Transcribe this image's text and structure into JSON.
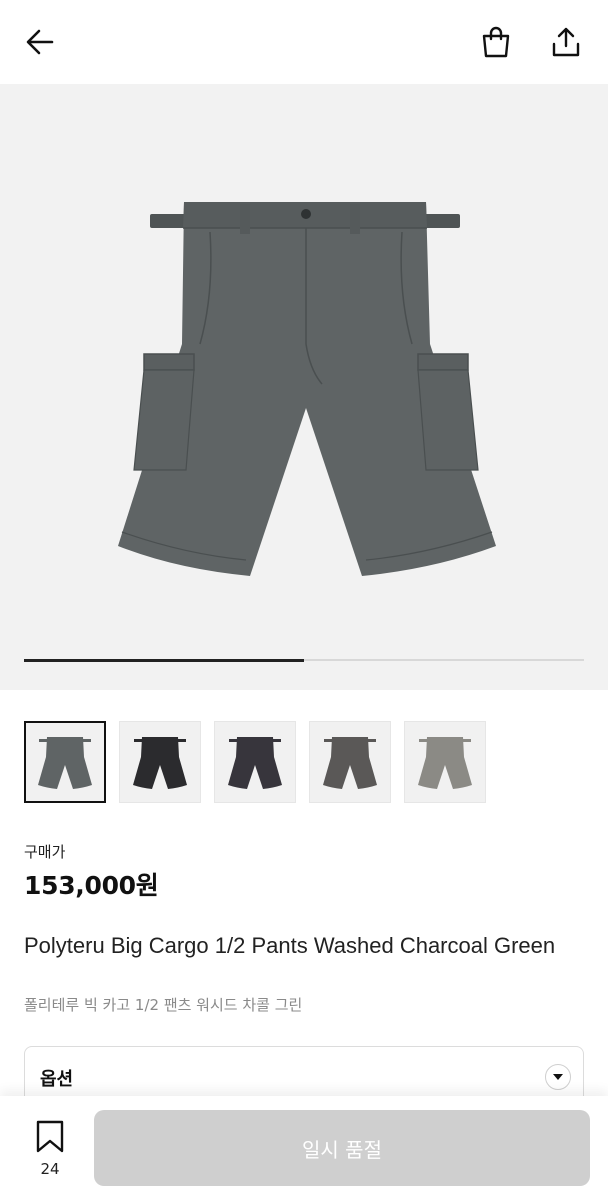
{
  "header": {
    "back_icon": "arrow-left-icon",
    "bag_icon": "shopping-bag-icon",
    "share_icon": "share-icon"
  },
  "gallery": {
    "progress_fraction": 0.5,
    "image_colors": [
      "#5f6465",
      "#2b2b2e",
      "#37353c",
      "#5a5857",
      "#8b8a85"
    ],
    "selected_index": 0
  },
  "product": {
    "price_label": "구매가",
    "price": "153,000원",
    "title_en": "Polyteru Big Cargo 1/2 Pants Washed Charcoal Green",
    "title_ko": "폴리테루 빅 카고 1/2 팬츠 워시드 차콜 그린"
  },
  "option": {
    "label": "옵션",
    "chevron_icon": "chevron-down-icon"
  },
  "bottom_bar": {
    "bookmark_icon": "bookmark-icon",
    "wish_count": "24",
    "soldout_label": "일시 품절"
  },
  "colors": {
    "accent": "#111111",
    "disabled_button": "#cfcfcf",
    "hero_bg": "#f2f2f2"
  }
}
